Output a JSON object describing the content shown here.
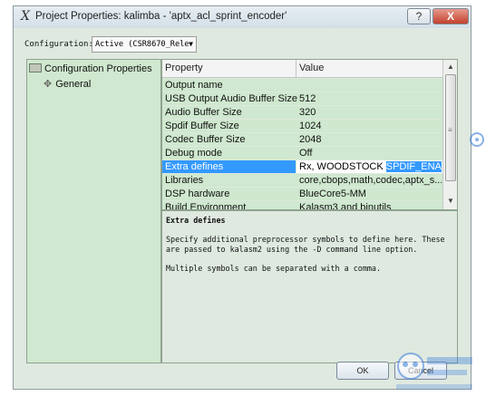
{
  "window": {
    "logo": "X",
    "title": "Project Properties: kalimba - 'aptx_acl_sprint_encoder'",
    "help_label": "?",
    "close_label": "X"
  },
  "configuration": {
    "label": "Configuration:",
    "selected": "Active (CSR8670_Rele"
  },
  "tree": {
    "items": [
      {
        "label": "Configuration Properties"
      },
      {
        "label": "General"
      }
    ]
  },
  "grid": {
    "columns": [
      "Property",
      "Value"
    ],
    "rows": [
      {
        "name": "Output name",
        "value": ""
      },
      {
        "name": "USB Output Audio Buffer Size",
        "value": "512"
      },
      {
        "name": "Audio Buffer Size",
        "value": "320"
      },
      {
        "name": "Spdif Buffer Size",
        "value": "1024"
      },
      {
        "name": "Codec Buffer Size",
        "value": "2048"
      },
      {
        "name": "Debug mode",
        "value": "Off"
      },
      {
        "name": "Extra defines",
        "value": "Rx, WOODSTOCK ",
        "value_selected": "SPDIF_ENABLE"
      },
      {
        "name": "Libraries",
        "value": "core,cbops,math,codec,aptx_s..."
      },
      {
        "name": "DSP hardware",
        "value": "BlueCore5-MM"
      },
      {
        "name": "Build Environment",
        "value": "Kalasm3 and binutils"
      }
    ]
  },
  "description": {
    "title": "Extra defines",
    "lines": [
      "Specify additional preprocessor symbols to define here. These",
      "are passed to kalasm2 using the -D command line option.",
      "Multiple symbols can be separated with a comma."
    ]
  },
  "buttons": {
    "ok": "OK",
    "cancel": "Cancel"
  },
  "colors": {
    "panel": "#cfe8cf",
    "selection": "#3399ff",
    "close": "#c4402c"
  }
}
